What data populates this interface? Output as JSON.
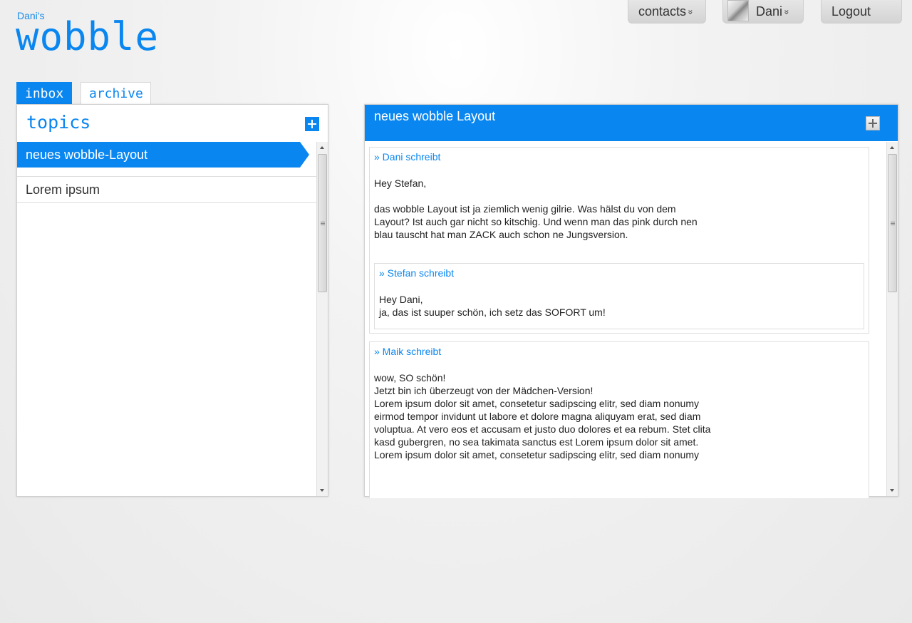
{
  "brand": {
    "owner": "Dani's",
    "name": "wobble"
  },
  "topnav": {
    "contacts_label": "contacts",
    "user_label": "Dani",
    "logout_label": "Logout",
    "chevron": "»"
  },
  "tabs": [
    {
      "label": "inbox",
      "active": true
    },
    {
      "label": "archive",
      "active": false
    }
  ],
  "topics_panel": {
    "title": "topics",
    "items": [
      {
        "label": "neues wobble-Layout",
        "active": true
      },
      {
        "label": "Lorem ipsum",
        "active": false
      }
    ]
  },
  "thread": {
    "title": "neues wobble Layout",
    "posts": [
      {
        "author": "» Dani schreibt",
        "body": "Hey Stefan,\n\ndas wobble Layout ist ja ziemlich wenig gilrie. Was hälst du von dem\nLayout? Ist auch gar nicht so kitschig. Und wenn man das pink durch nen\nblau tauscht hat man ZACK auch schon ne Jungsversion.",
        "reply": {
          "author": "» Stefan schreibt",
          "body": "Hey Dani,\nja, das ist suuper schön, ich setz das SOFORT um!"
        }
      },
      {
        "author": "» Maik schreibt",
        "body": "wow, SO schön!\nJetzt bin ich überzeugt von der Mädchen-Version!\nLorem ipsum dolor sit amet, consetetur sadipscing elitr, sed diam nonumy\neirmod tempor invidunt ut labore et dolore magna aliquyam erat, sed diam\nvoluptua. At vero eos et accusam et justo duo dolores et ea rebum. Stet clita\nkasd gubergren, no sea takimata sanctus est Lorem ipsum dolor sit amet.\nLorem ipsum dolor sit amet, consetetur sadipscing elitr, sed diam nonumy"
      }
    ]
  },
  "colors": {
    "accent": "#0a86f0",
    "background": "#ededed"
  }
}
